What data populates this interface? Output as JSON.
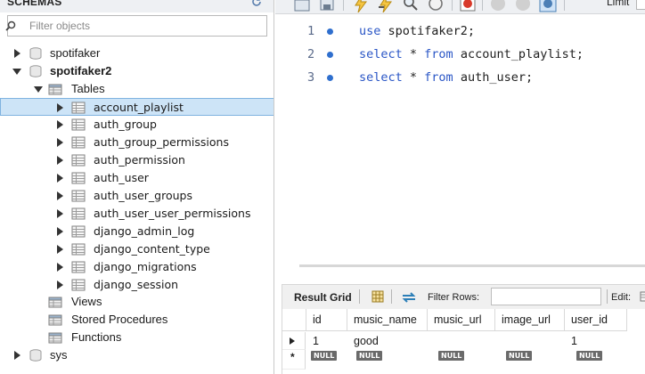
{
  "navigator": {
    "title": "SCHEMAS",
    "filter_placeholder": "Filter objects",
    "schemas": [
      {
        "name": "spotifaker",
        "expanded": false
      },
      {
        "name": "spotifaker2",
        "expanded": true,
        "bold": true
      },
      {
        "name": "sys",
        "expanded": false
      }
    ],
    "tables_label": "Tables",
    "tables": [
      "account_playlist",
      "auth_group",
      "auth_group_permissions",
      "auth_permission",
      "auth_user",
      "auth_user_groups",
      "auth_user_user_permissions",
      "django_admin_log",
      "django_content_type",
      "django_migrations",
      "django_session"
    ],
    "selected_table": "account_playlist",
    "views_label": "Views",
    "procedures_label": "Stored Procedures",
    "functions_label": "Functions"
  },
  "toolbar": {
    "icons": [
      "open-folder-icon",
      "save-icon",
      "execute-icon",
      "execute-current-icon",
      "explain-icon",
      "stop-icon",
      "toggle-error-icon",
      "commit-icon",
      "rollback-icon",
      "autocommit-icon"
    ],
    "limit_label": "Limit"
  },
  "editor": {
    "lines": [
      {
        "number": "1",
        "keyword": "use",
        "rest": " spotifaker2;"
      },
      {
        "number": "2",
        "keyword": "select",
        "middle": " * ",
        "keyword2": "from",
        "rest": " account_playlist;"
      },
      {
        "number": "3",
        "keyword": "select",
        "middle": " * ",
        "keyword2": "from",
        "rest": " auth_user;"
      }
    ]
  },
  "result": {
    "tab_label": "Result Grid",
    "filter_rows_label": "Filter Rows:",
    "filter_rows_value": "",
    "edit_label": "Edit:",
    "columns": [
      "id",
      "music_name",
      "music_url",
      "image_url",
      "user_id"
    ],
    "rows": [
      {
        "id": "1",
        "music_name": "good",
        "music_url": "",
        "image_url": "",
        "user_id": "1"
      }
    ],
    "new_row_null": "NULL"
  },
  "colors": {
    "keyword": "#2a56c6",
    "selection": "#cde4f7",
    "line_marker": "#2f6fce"
  }
}
